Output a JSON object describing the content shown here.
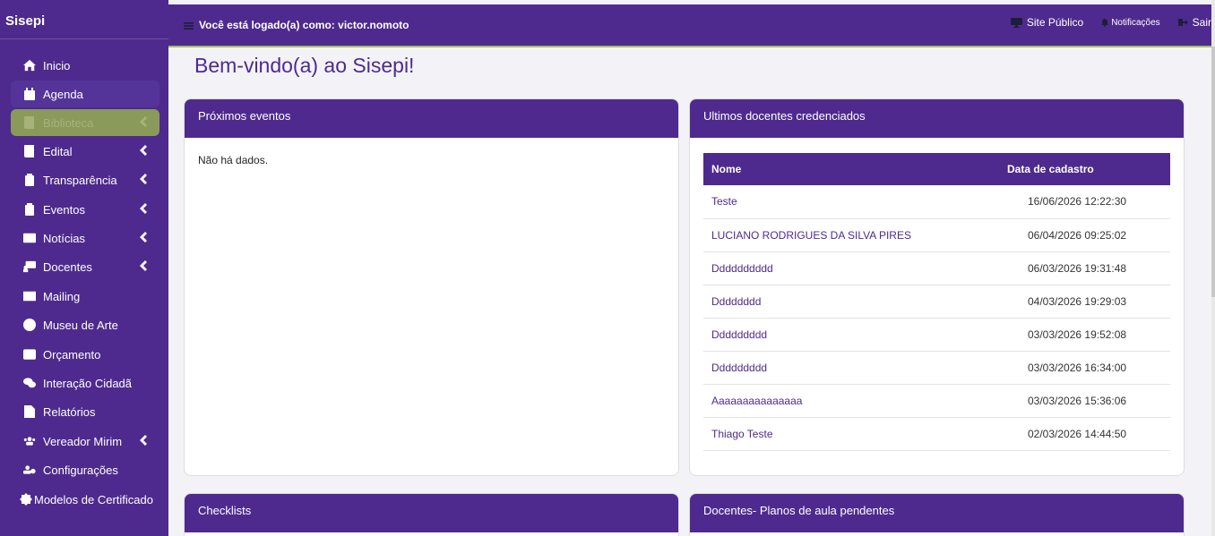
{
  "app": {
    "title": "Sisepi"
  },
  "sidebar": {
    "items": [
      {
        "label": "Inicio",
        "icon": "home-icon"
      },
      {
        "label": "Agenda",
        "icon": "calendar-icon"
      },
      {
        "label": "Biblioteca",
        "icon": "book-icon"
      },
      {
        "label": "Edital",
        "icon": "book-icon"
      },
      {
        "label": "Transparência",
        "icon": "clipboard-icon"
      },
      {
        "label": "Eventos",
        "icon": "clipboard-check-icon"
      },
      {
        "label": "Notícias",
        "icon": "newspaper-icon"
      },
      {
        "label": "Docentes",
        "icon": "teacher-icon"
      },
      {
        "label": "Mailing",
        "icon": "envelope-icon"
      },
      {
        "label": "Museu de Arte",
        "icon": "palette-icon"
      },
      {
        "label": "Orçamento",
        "icon": "wallet-icon"
      },
      {
        "label": "Interação Cidadã",
        "icon": "comments-icon"
      },
      {
        "label": "Relatórios",
        "icon": "file-icon"
      },
      {
        "label": "Vereador Mirim",
        "icon": "users-icon"
      },
      {
        "label": "Configurações",
        "icon": "users-cog-icon"
      },
      {
        "label": "Modelos de Certificado",
        "icon": "certificate-icon"
      }
    ]
  },
  "topbar": {
    "logged_text": "Você está logado(a) como: victor.nomoto",
    "site_publico": "Site Público",
    "notificacoes": "Notificações",
    "sair": "Sair"
  },
  "main": {
    "title": "Bem-vindo(a) ao Sisepi!",
    "proximos_eventos": {
      "title": "Próximos eventos",
      "empty": "Não há dados."
    },
    "docentes": {
      "title": "Ultimos docentes credenciados",
      "col_nome": "Nome",
      "col_data": "Data de cadastro",
      "rows": [
        {
          "nome": "Teste",
          "data": "16/06/2026 12:22:30"
        },
        {
          "nome": "LUCIANO RODRIGUES DA SILVA PIRES",
          "data": "06/04/2026 09:25:02"
        },
        {
          "nome": "Dddddddddd",
          "data": "06/03/2026 19:31:48"
        },
        {
          "nome": "Dddddddd",
          "data": "04/03/2026 19:29:03"
        },
        {
          "nome": "Ddddddddd",
          "data": "03/03/2026 19:52:08"
        },
        {
          "nome": "Ddddddddd",
          "data": "03/03/2026 16:34:00"
        },
        {
          "nome": "Aaaaaaaaaaaaaaa",
          "data": "03/03/2026 15:36:06"
        },
        {
          "nome": "Thiago Teste",
          "data": "02/03/2026 14:44:50"
        }
      ]
    },
    "checklists": {
      "title": "Checklists"
    },
    "planos": {
      "title": "Docentes- Planos de aula pendentes"
    }
  },
  "colors": {
    "brand": "#4e2a8e",
    "accent_line": "#9bc15a",
    "active_item": "#8a9a5b"
  }
}
